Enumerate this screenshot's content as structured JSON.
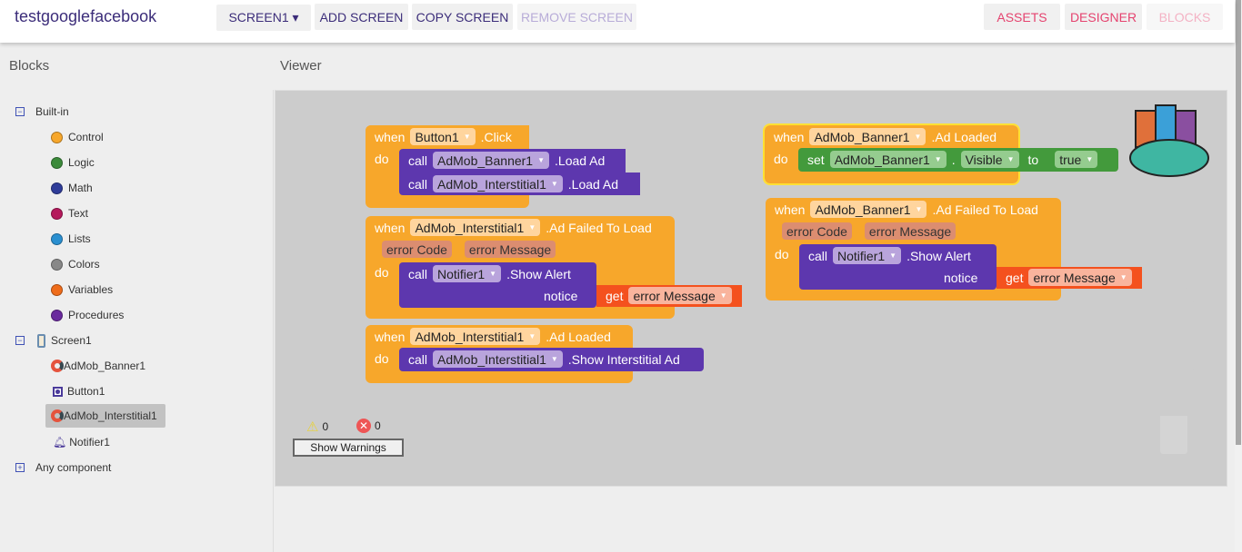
{
  "app": {
    "title": "testgooglefacebook"
  },
  "toolbar": {
    "screen": "SCREEN1 ▾",
    "add": "ADD SCREEN",
    "copy": "COPY SCREEN",
    "remove": "REMOVE SCREEN",
    "assets": "ASSETS",
    "designer": "DESIGNER",
    "blocks": "BLOCKS"
  },
  "sidebar": {
    "title": "Blocks",
    "builtin": "Built-in",
    "builtins": [
      {
        "label": "Control",
        "color": "#f7a72b"
      },
      {
        "label": "Logic",
        "color": "#3b8a3a"
      },
      {
        "label": "Math",
        "color": "#2f3c99"
      },
      {
        "label": "Text",
        "color": "#b5195c"
      },
      {
        "label": "Lists",
        "color": "#2a8fd0"
      },
      {
        "label": "Colors",
        "color": "#888888"
      },
      {
        "label": "Variables",
        "color": "#ef6c1a"
      },
      {
        "label": "Procedures",
        "color": "#6a2a9e"
      }
    ],
    "screen": "Screen1",
    "components": [
      "AdMob_Banner1",
      "Button1",
      "AdMob_Interstitial1",
      "Notifier1"
    ],
    "any": "Any component"
  },
  "viewer": {
    "title": "Viewer",
    "warnings": "0",
    "errors": "0",
    "show_warnings": "Show Warnings"
  },
  "kw": {
    "when": "when",
    "do": "do",
    "call": "call",
    "set": "set",
    "to": "to",
    "get": "get",
    "notice": "notice"
  },
  "blocks": {
    "b1": {
      "comp": "Button1",
      "event": ".Click",
      "c1": "AdMob_Banner1",
      "m1": ".Load Ad",
      "c2": "AdMob_Interstitial1",
      "m2": ".Load Ad"
    },
    "b2": {
      "comp": "AdMob_Interstitial1",
      "event": ".Ad Failed To Load",
      "p1": "error Code",
      "p2": "error Message",
      "c": "Notifier1",
      "m": ".Show Alert",
      "v": "error Message"
    },
    "b3": {
      "comp": "AdMob_Interstitial1",
      "event": ".Ad Loaded",
      "c": "AdMob_Interstitial1",
      "m": ".Show Interstitial Ad"
    },
    "b4": {
      "comp": "AdMob_Banner1",
      "event": ".Ad Loaded",
      "sc": "AdMob_Banner1",
      "prop": "Visible",
      "val": "true"
    },
    "b5": {
      "comp": "AdMob_Banner1",
      "event": ".Ad Failed To Load",
      "p1": "error Code",
      "p2": "error Message",
      "c": "Notifier1",
      "m": ".Show Alert",
      "v": "error Message"
    }
  }
}
